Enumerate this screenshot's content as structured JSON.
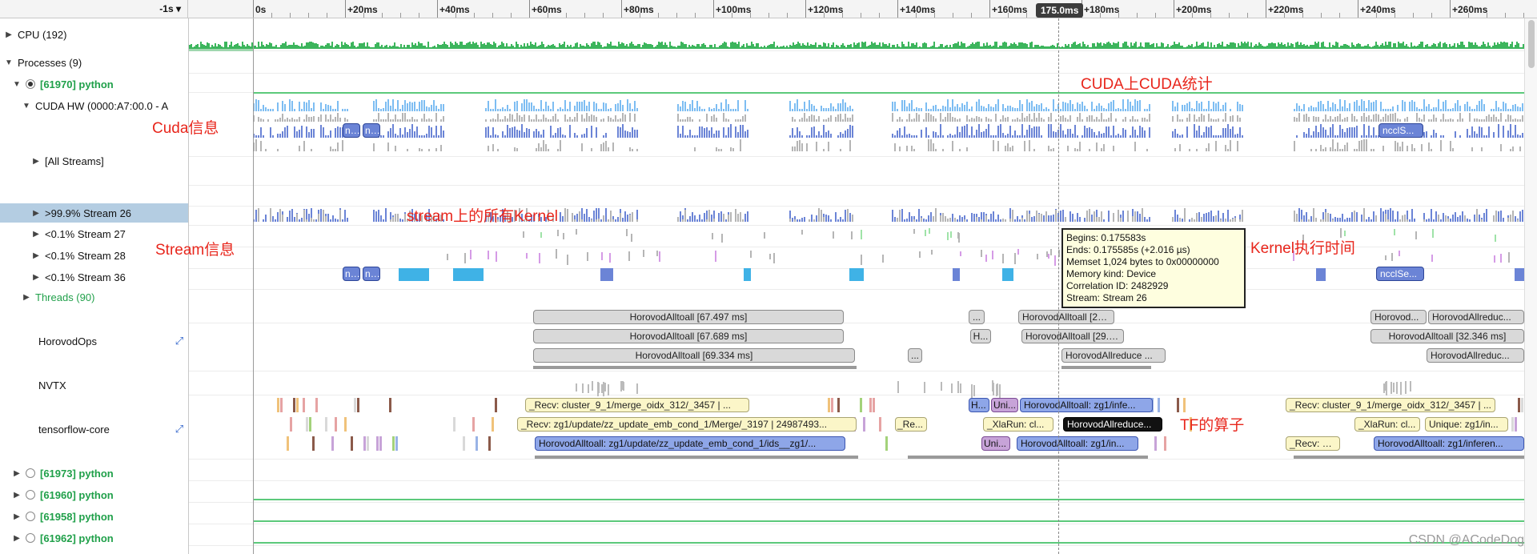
{
  "ruler": {
    "left_label": "-1s ▾",
    "ticks": [
      "0s",
      "+20ms",
      "+40ms",
      "+60ms",
      "+80ms",
      "+100ms",
      "+120ms",
      "+140ms",
      "+160ms",
      "+180ms",
      "+200ms",
      "+220ms",
      "+240ms",
      "+260ms"
    ],
    "hover_time": "175.0ms"
  },
  "rows": {
    "cpu": "CPU (192)",
    "processes": "Processes (9)",
    "proc_main": "[61970] python",
    "cuda_hw": "CUDA HW (0000:A7:00.0 - A",
    "all_streams": "[All Streams]",
    "stream26": ">99.9% Stream 26",
    "stream27": "<0.1% Stream 27",
    "stream28": "<0.1% Stream 28",
    "stream36": "<0.1% Stream 36",
    "threads": "Threads (90)",
    "horovod": "HorovodOps",
    "nvtx": "NVTX",
    "tf_core": "tensorflow-core",
    "proc_a": "[61973] python",
    "proc_b": "[61960] python",
    "proc_c": "[61958] python",
    "proc_d": "[61962] python"
  },
  "annotations": {
    "cuda_stats": "CUDA上CUDA统计",
    "cuda_info": "Cuda信息",
    "stream_kernels": "stream上的所有Kernel",
    "stream_info": "Stream信息",
    "kernel_time": "Kernel执行时间",
    "tf_ops": "TF的算子"
  },
  "tooltip": {
    "begins": "Begins: 0.175583s",
    "ends": "Ends: 0.175585s (+2.016 µs)",
    "memset": "Memset 1,024 bytes to 0x00000000",
    "memory_kind": "Memory kind: Device",
    "correlation": "Correlation ID: 2482929",
    "stream": "Stream: Stream 26"
  },
  "stream_chips": {
    "n1": "n...",
    "n2": "n...",
    "nccl1": "ncclS...",
    "n3": "n...",
    "n4": "n...",
    "nccl2": "ncclSe..."
  },
  "horovod_blocks": {
    "r1a": "HorovodAlltoall [67.497 ms]",
    "r1b": "...",
    "r1c": "HorovodAlltoall [26.91...",
    "r1d": "Horovod...",
    "r1e": "HorovodAllreduc...",
    "r2a": "HorovodAlltoall [67.689 ms]",
    "r2b": "H...",
    "r2c": "HorovodAlltoall [29.122 ...",
    "r2d": "HorovodAlltoall [32.346 ms]",
    "r3a": "HorovodAlltoall [69.334 ms]",
    "r3b": "...",
    "r3c": "HorovodAllreduce ...",
    "r3d": "HorovodAllreduc..."
  },
  "tf_blocks": {
    "r1a": "_Recv: cluster_9_1/merge_oidx_312/_3457 | ...",
    "r1b": "H...",
    "r1c": "Uni...",
    "r1d": "HorovodAlltoall: zg1/infe...",
    "r1e": "_Recv: cluster_9_1/merge_oidx_312/_3457 | ...",
    "r2a": "_Recv: zg1/update/zz_update_emb_cond_1/Merge/_3197 | 24987493...",
    "r2b": "_Re...",
    "r2c": "_XlaRun: cl...",
    "r2d": "HorovodAllreduce...",
    "r2e": "_XlaRun: cl...",
    "r2f": "Unique: zg1/in...",
    "r3a": "HorovodAlltoall: zg1/update/zz_update_emb_cond_1/ids__zg1/...",
    "r3b": "Uni...",
    "r3c": "HorovodAlltoall: zg1/in...",
    "r3d": "_Recv: gl...",
    "r3e": "HorovodAlltoall: zg1/inferen..."
  },
  "watermark": "CSDN @ACodeDog",
  "colors": {
    "cpu_green": "#3cb55c",
    "kernel_blue": "#6b84d6",
    "memcpy_cyan": "#3fb2e6",
    "light_blue": "#7dbdf2",
    "grey_bar": "#b5b5b5",
    "annotation_red": "#e8261c",
    "selection": "#b4cde2",
    "process_green": "#20a04a"
  }
}
